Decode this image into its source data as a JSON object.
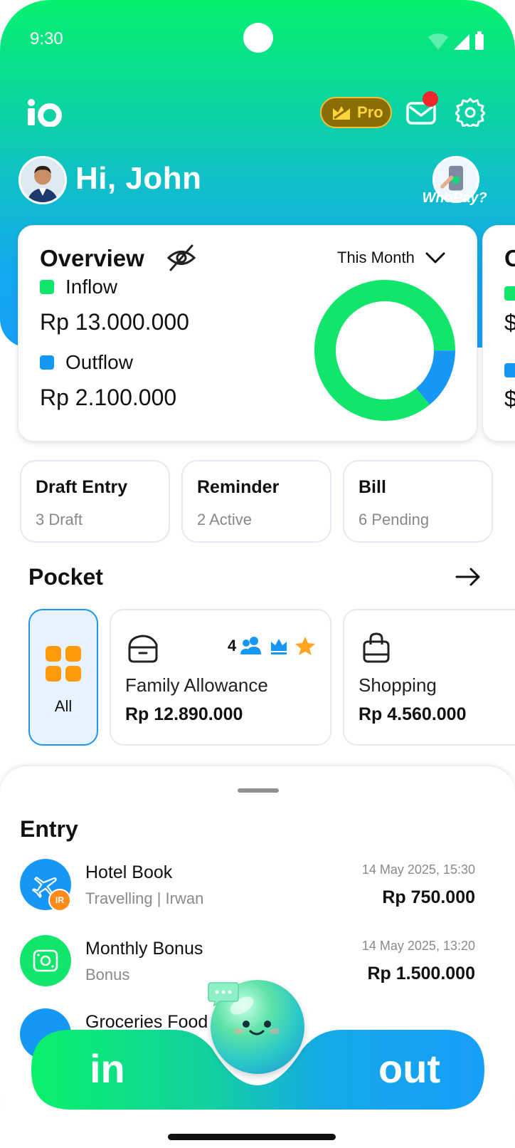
{
  "status_bar": {
    "time": "9:30"
  },
  "header": {
    "logo": "io-logo",
    "pro_label": "Pro",
    "greeting": "Hi, John",
    "whopay_label": "WhoPay?",
    "icons": [
      "crown-icon",
      "mail-icon",
      "gear-icon"
    ]
  },
  "overview": {
    "title": "Overview",
    "period": "This Month",
    "inflow_label": "Inflow",
    "inflow_amount": "Rp 13.000.000",
    "outflow_label": "Outflow",
    "outflow_amount": "Rp 2.100.000",
    "inflow_share": 0.86,
    "colors": {
      "inflow": "#11e66a",
      "outflow": "#1597f6"
    }
  },
  "peek_card": {
    "title": "O",
    "value1": "$",
    "value2": "$"
  },
  "quick_cards": [
    {
      "title": "Draft Entry",
      "sub": "3 Draft"
    },
    {
      "title": "Reminder",
      "sub": "2 Active"
    },
    {
      "title": "Bill",
      "sub": "6 Pending"
    }
  ],
  "pocket": {
    "title": "Pocket",
    "all_label": "All",
    "items": [
      {
        "name": "Family Allowance",
        "amount": "Rp 12.890.000",
        "members": "4",
        "icon": "wallet-icon"
      },
      {
        "name": "Shopping",
        "amount": "Rp 4.560.000",
        "icon": "shopping-bag-icon"
      }
    ]
  },
  "entry": {
    "title": "Entry",
    "rows": [
      {
        "title": "Hotel Book",
        "category": "Travelling",
        "person": "Irwan",
        "initials": "IR",
        "date": "14 May 2025, 15:30",
        "amount": "Rp 750.000",
        "icon": "airplane-icon",
        "color": "#1597f6"
      },
      {
        "title": "Monthly Bonus",
        "category": "Bonus",
        "date": "14 May 2025, 13:20",
        "amount": "Rp 1.500.000",
        "icon": "money-icon",
        "color": "#11e66a"
      },
      {
        "title": "Groceries Food",
        "icon": "food-icon",
        "color": "#1597f6"
      }
    ]
  },
  "bottom_bar": {
    "in_label": "in",
    "out_label": "out",
    "separator": "|"
  }
}
